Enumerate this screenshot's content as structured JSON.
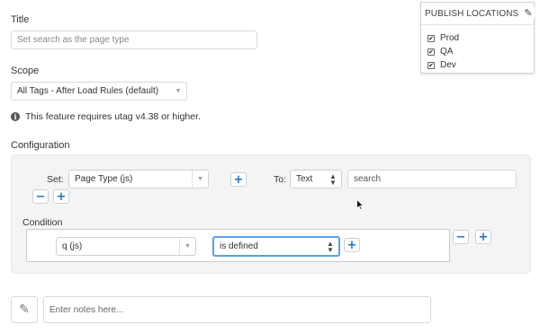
{
  "title_section": {
    "label": "Title",
    "placeholder": "Set search as the page type"
  },
  "scope_section": {
    "label": "Scope",
    "selected": "All Tags - After Load Rules (default)"
  },
  "notice": {
    "text": "This feature requires utag v4.38 or higher."
  },
  "configuration": {
    "label": "Configuration",
    "set_label": "Set:",
    "set_value": "Page Type (js)",
    "to_label": "To:",
    "to_type": "Text",
    "to_value": "search",
    "condition_label": "Condition",
    "condition_variable": "q (js)",
    "condition_operator": "is defined"
  },
  "publish_locations": {
    "title": "PUBLISH LOCATIONS",
    "items": [
      {
        "label": "Prod",
        "checked": true
      },
      {
        "label": "QA",
        "checked": true
      },
      {
        "label": "Dev",
        "checked": true
      }
    ]
  },
  "notes": {
    "placeholder": "Enter notes here..."
  },
  "icons": {
    "info": "info-circle-icon",
    "edit": "pencil-icon",
    "notes": "pencil-icon",
    "cursor": "mouse-pointer-icon"
  },
  "colors": {
    "accent": "#1a73c8",
    "panel_bg": "#f3f4f6",
    "focus_border": "#5aa0e6"
  }
}
